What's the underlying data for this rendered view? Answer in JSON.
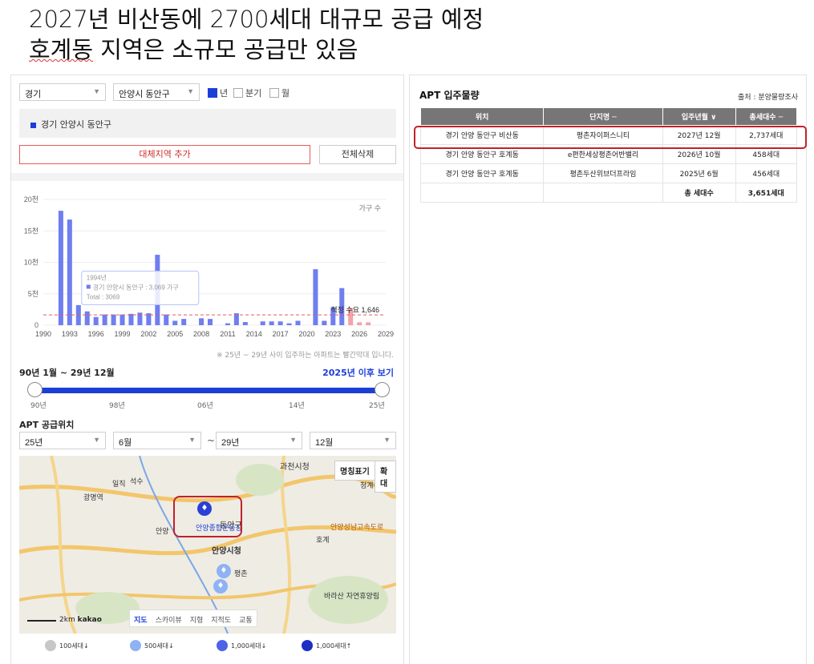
{
  "headline": {
    "line1": "2027년 비산동에 2700세대 대규모 공급 예정",
    "line2_underlined": "호계동",
    "line2_rest": " 지역은 소규모 공급만 있음"
  },
  "filters": {
    "province": "경기",
    "district": "안양시 동안구",
    "period_options": [
      {
        "label": "년",
        "checked": true
      },
      {
        "label": "분기",
        "checked": false
      },
      {
        "label": "월",
        "checked": false
      }
    ]
  },
  "selected_region": "경기 안양시 동안구",
  "buttons": {
    "add_region": "대체지역 추가",
    "delete_all": "전체삭제"
  },
  "chart_data": {
    "type": "bar",
    "x": [
      1990,
      1991,
      1992,
      1993,
      1994,
      1995,
      1996,
      1997,
      1998,
      1999,
      2000,
      2001,
      2002,
      2003,
      2004,
      2005,
      2006,
      2007,
      2008,
      2009,
      2010,
      2011,
      2012,
      2013,
      2014,
      2015,
      2016,
      2017,
      2018,
      2019,
      2020,
      2021,
      2022,
      2023,
      2024,
      2025,
      2026,
      2027,
      2028,
      2029
    ],
    "values": [
      0,
      0,
      18200,
      16800,
      3200,
      2200,
      1300,
      1700,
      1700,
      1700,
      1800,
      2000,
      1900,
      11200,
      1700,
      700,
      1000,
      0,
      1100,
      1000,
      0,
      300,
      1900,
      500,
      0,
      600,
      600,
      600,
      300,
      700,
      0,
      8900,
      700,
      2800,
      5900,
      2737,
      458,
      456,
      0,
      0
    ],
    "future_from": 2025,
    "colors": {
      "past": "#6f7ef0",
      "future": "#f3a3a6",
      "demand_line": "#e85a5a"
    },
    "ylim": [
      0,
      20000
    ],
    "y_ticks": [
      0,
      5000,
      10000,
      15000,
      20000
    ],
    "y_tick_labels": [
      "0",
      "5천",
      "10천",
      "15천",
      "20천"
    ],
    "x_tick_labels": [
      "1990",
      "1993",
      "1996",
      "1999",
      "2002",
      "2005",
      "2008",
      "2011",
      "2014",
      "2017",
      "2020",
      "2023",
      "2026",
      "2029"
    ],
    "series_label": "가구 수",
    "demand": {
      "value": 1646,
      "label": "적정 수요 1,646"
    },
    "tooltip": {
      "line1": "1994년",
      "line2": "경기 안양시 동안구 : 3,069 가구",
      "line3": "Total : 3069"
    },
    "note": "※ 25년 ~ 29년 사이 입주하는 아파트는 빨간막대 입니다."
  },
  "range": {
    "title": "90년 1월 ~ 29년 12월",
    "link": "2025년 이후 보기",
    "ticks": [
      "90년",
      "98년",
      "06년",
      "14년",
      "25년"
    ]
  },
  "supply": {
    "title": "APT 공급위치",
    "from_year": "25년",
    "from_month": "6월",
    "tilde": "~",
    "to_year": "29년",
    "to_month": "12월"
  },
  "map": {
    "btn_label_name": "명칭표기",
    "btn_zoom": "확대",
    "tabs": [
      "지도",
      "스카이뷰",
      "지형",
      "지적도",
      "교통"
    ],
    "scale": "2km",
    "brand": "kakao",
    "labels": [
      "과천시청",
      "안양시청",
      "안양종합운동장",
      "동안구",
      "평촌",
      "바라산 자연휴양림",
      "광명역",
      "안양",
      "석수",
      "일직",
      "청계산",
      "호계",
      "안양성남고속도로"
    ]
  },
  "legend": [
    "100세대↓",
    "500세대↓",
    "1,000세대↓",
    "1,000세대↑"
  ],
  "table": {
    "title": "APT 입주물량",
    "source": "출처 : 분양물량조사",
    "headers": [
      "위치",
      "단지명 ─",
      "입주년월 ∨",
      "총세대수 ─"
    ],
    "rows": [
      [
        "경기 안양 동안구 비산동",
        "평촌자이퍼스니티",
        "2027년 12월",
        "2,737세대"
      ],
      [
        "경기 안양 동안구 호계동",
        "e편한세상평촌어반밸리",
        "2026년 10월",
        "458세대"
      ],
      [
        "경기 안양 동안구 호계동",
        "평촌두산위브더프라임",
        "2025년 6월",
        "456세대"
      ]
    ],
    "total_label": "총 세대수",
    "total_value": "3,651세대"
  }
}
